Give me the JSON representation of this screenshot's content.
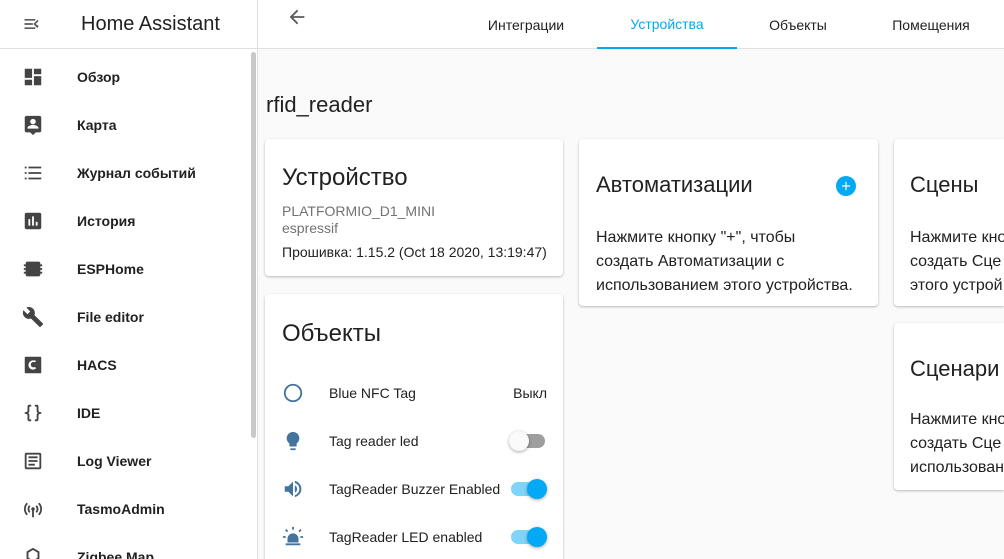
{
  "app": {
    "title": "Home Assistant"
  },
  "sidebar": {
    "items": [
      {
        "label": "Обзор",
        "icon": "dashboard-icon"
      },
      {
        "label": "Карта",
        "icon": "map-account-icon"
      },
      {
        "label": "Журнал событий",
        "icon": "logbook-icon"
      },
      {
        "label": "История",
        "icon": "chart-box-icon"
      },
      {
        "label": "ESPHome",
        "icon": "chip-icon"
      },
      {
        "label": "File editor",
        "icon": "wrench-icon"
      },
      {
        "label": "HACS",
        "icon": "hacs-icon"
      },
      {
        "label": "IDE",
        "icon": "code-braces-icon"
      },
      {
        "label": "Log Viewer",
        "icon": "text-box-icon"
      },
      {
        "label": "TasmoAdmin",
        "icon": "access-point-icon"
      },
      {
        "label": "Zigbee Map",
        "icon": "graph-icon"
      }
    ]
  },
  "tabs": [
    {
      "label": "Интеграции",
      "active": false
    },
    {
      "label": "Устройства",
      "active": true
    },
    {
      "label": "Объекты",
      "active": false
    },
    {
      "label": "Помещения",
      "active": false
    }
  ],
  "colors": {
    "accent": "#03a9f4",
    "icon": "#44739e"
  },
  "page": {
    "title": "rfid_reader"
  },
  "device_card": {
    "title": "Устройство",
    "model": "PLATFORMIO_D1_MINI",
    "manufacturer": "espressif",
    "firmware": "Прошивка: 1.15.2 (Oct 18 2020, 13:19:47)"
  },
  "entities_card": {
    "title": "Объекты",
    "entities": [
      {
        "name": "Blue NFC Tag",
        "icon": "circle-outline-icon",
        "state": "Выкл"
      },
      {
        "name": "Tag reader led",
        "icon": "lightbulb-icon",
        "toggle": false
      },
      {
        "name": "TagReader Buzzer Enabled",
        "icon": "volume-high-icon",
        "toggle": true
      },
      {
        "name": "TagReader LED enabled",
        "icon": "alarm-light-icon",
        "toggle": true
      }
    ]
  },
  "automations_card": {
    "title": "Автоматизации",
    "line1": "Нажмите кнопку \"+\", чтобы",
    "line2": "создать Автоматизации с",
    "line3": "использованием этого устройства."
  },
  "scenes_card": {
    "title": "Сцены",
    "line1": "Нажмите кно",
    "line2": "создать Сце",
    "line3": "этого устрой"
  },
  "scripts_card": {
    "title": "Сценари",
    "line1": "Нажмите кно",
    "line2": "создать Сце",
    "line3": "использован"
  }
}
